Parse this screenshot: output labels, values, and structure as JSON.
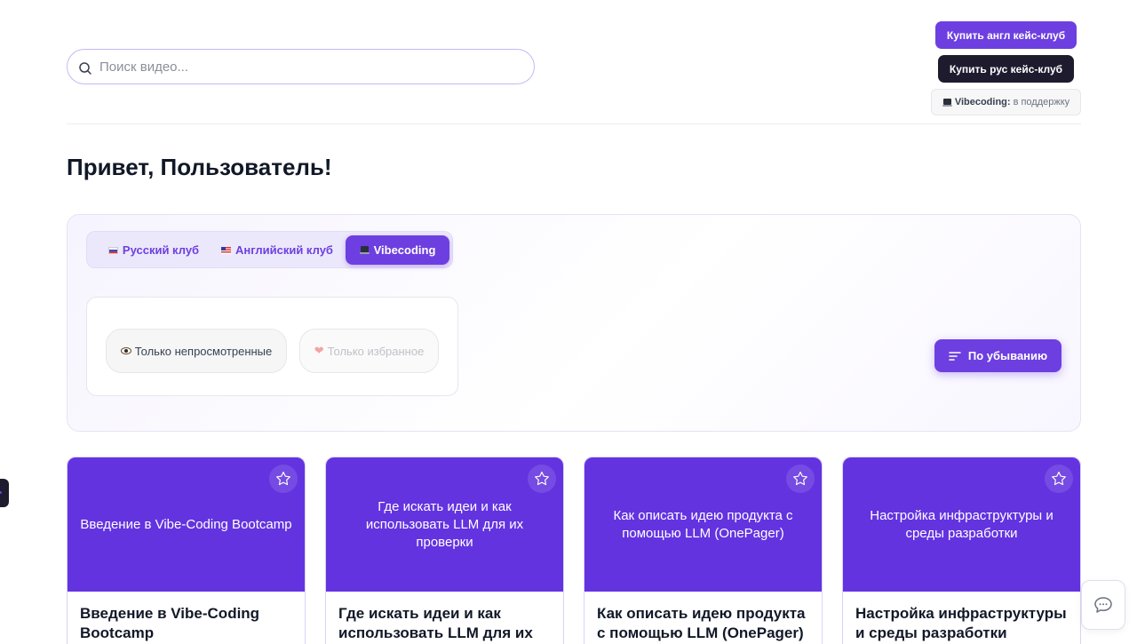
{
  "search": {
    "placeholder": "Поиск видео..."
  },
  "header": {
    "buy_en": "Купить англ кейс-клуб",
    "buy_ru": "Купить рус кейс-клуб",
    "badge_strong": "Vibecoding:",
    "badge_text": "в поддержку"
  },
  "greeting": "Привет, Пользователь!",
  "tabs": [
    {
      "label": "Русский клуб",
      "icon": "flag-ru-icon"
    },
    {
      "label": "Английский клуб",
      "icon": "flag-us-icon"
    },
    {
      "label": "Vibecoding",
      "icon": "laptop-icon",
      "active": true
    }
  ],
  "filters": {
    "unwatched": "Только непросмотренные",
    "favorites": "Только избранное"
  },
  "sort": {
    "label": "По убыванию"
  },
  "cards": [
    {
      "thumb": "Введение в Vibe-Coding Bootcamp",
      "title": "Введение в Vibe-Coding Bootcamp"
    },
    {
      "thumb": "Где искать идеи и как использовать LLM для их проверки",
      "title": "Где искать идеи и как использовать LLM для их"
    },
    {
      "thumb": "Как описать идею продукта с помощью LLM (OnePager)",
      "title": "Как описать идею продукта с помощью LLM (OnePager)"
    },
    {
      "thumb": "Настройка инфраструктуры и среды разработки",
      "title": "Настройка инфраструктуры и среды разработки"
    }
  ],
  "colors": {
    "accent": "#6d3fe0",
    "card_bg": "#6333e0",
    "dark": "#1e1b2e"
  }
}
